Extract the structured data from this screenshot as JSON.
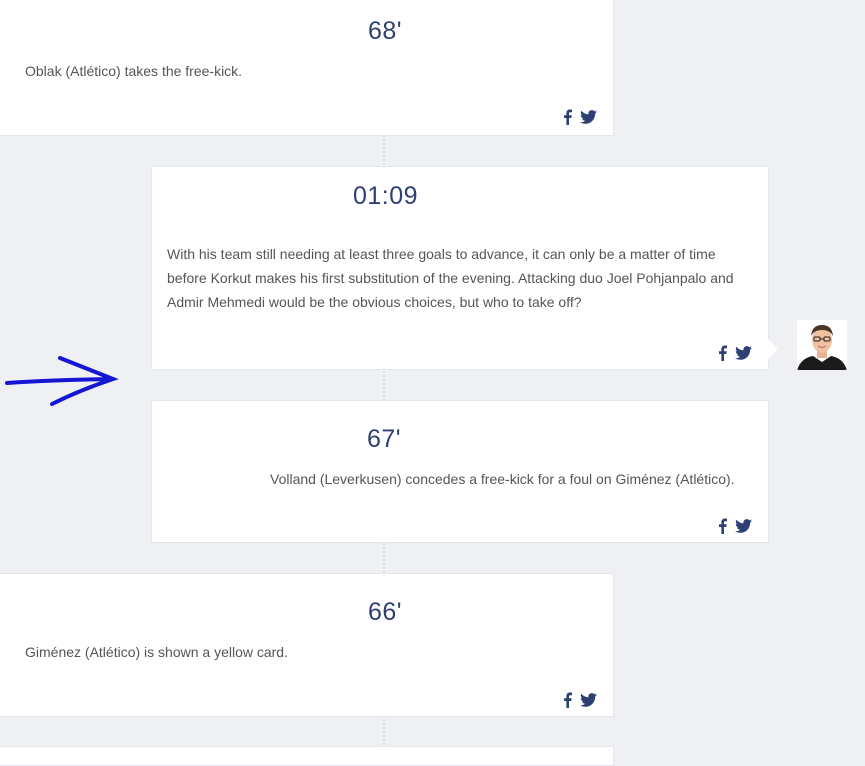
{
  "entries": [
    {
      "time": "68'",
      "text": "Oblak (Atlético) takes the free-kick."
    },
    {
      "time": "01:09",
      "text": "With his team still needing at least three goals to advance, it can only be a matter of time before Korkut makes his first substitution of the evening. Attacking duo Joel Pohjanpalo and Admir Mehmedi would be the obvious choices, but who to take off?"
    },
    {
      "time": "67'",
      "text": "Volland (Leverkusen) concedes a free-kick for a foul on Giménez (Atlético)."
    },
    {
      "time": "66'",
      "text": "Giménez (Atlético) is shown a yellow card."
    }
  ],
  "icons": {
    "share_facebook": "facebook-icon",
    "share_twitter": "twitter-icon",
    "annotation": "blue-arrow",
    "author": "author-avatar"
  },
  "colors": {
    "accent": "#2e3f73",
    "background": "#eef0f3",
    "annotation": "#1515d4"
  }
}
